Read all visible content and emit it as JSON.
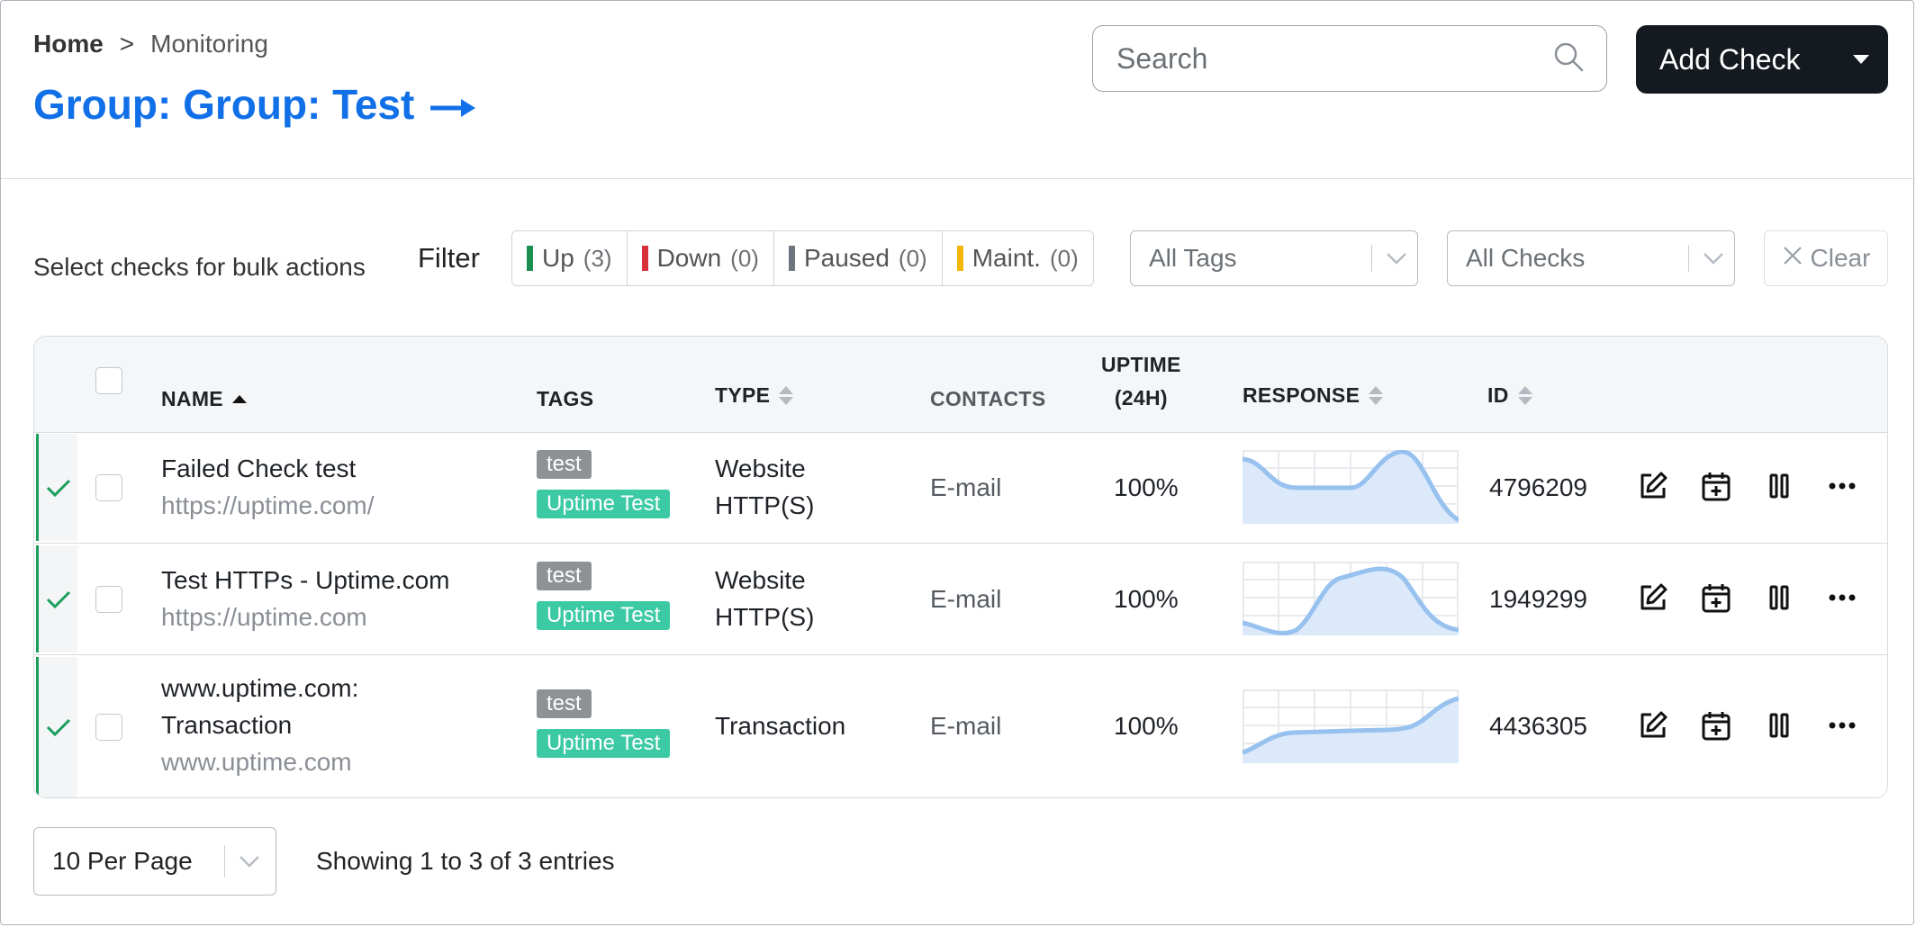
{
  "breadcrumb": {
    "home": "Home",
    "separator": ">",
    "current": "Monitoring"
  },
  "page_title": "Group: Group: Test",
  "search": {
    "placeholder": "Search",
    "value": ""
  },
  "add_check": {
    "label": "Add Check"
  },
  "bulk_text": "Select checks for bulk actions",
  "filter": {
    "label": "Filter",
    "segments": [
      {
        "label": "Up",
        "count": "(3)",
        "color": "#1a8f4f"
      },
      {
        "label": "Down",
        "count": "(0)",
        "color": "#d6303c"
      },
      {
        "label": "Paused",
        "count": "(0)",
        "color": "#6e7580"
      },
      {
        "label": "Maint.",
        "count": "(0)",
        "color": "#f2b705"
      }
    ],
    "tags_select": "All Tags",
    "checks_select": "All Checks",
    "clear_label": "Clear"
  },
  "columns": {
    "name": "NAME",
    "tags": "TAGS",
    "type": "TYPE",
    "contacts": "CONTACTS",
    "uptime_line1": "UPTIME",
    "uptime_line2": "(24H)",
    "response": "RESPONSE",
    "id": "ID"
  },
  "rows": [
    {
      "name": "Failed Check test",
      "url": "https://uptime.com/",
      "tag1": "test",
      "tag2": "Uptime Test",
      "type_line1": "Website",
      "type_line2": "HTTP(S)",
      "contacts": "E-mail",
      "uptime": "100%",
      "id": "4796209"
    },
    {
      "name": "Test HTTPs - Uptime.com",
      "url": "https://uptime.com",
      "tag1": "test",
      "tag2": "Uptime Test",
      "type_line1": "Website",
      "type_line2": "HTTP(S)",
      "contacts": "E-mail",
      "uptime": "100%",
      "id": "1949299"
    },
    {
      "name_line1": "www.uptime.com:",
      "name_line2": "Transaction",
      "url": "www.uptime.com",
      "tag1": "test",
      "tag2": "Uptime Test",
      "type_line1": "Transaction",
      "contacts": "E-mail",
      "uptime": "100%",
      "id": "4436305"
    }
  ],
  "pagination": {
    "per_page": "10 Per Page",
    "showing": "Showing 1 to 3 of 3 entries"
  },
  "colors": {
    "accent": "#1170e8",
    "up": "#1a9e5c",
    "tag_teal": "#3ccaa4",
    "spark": "#97c1ee"
  }
}
